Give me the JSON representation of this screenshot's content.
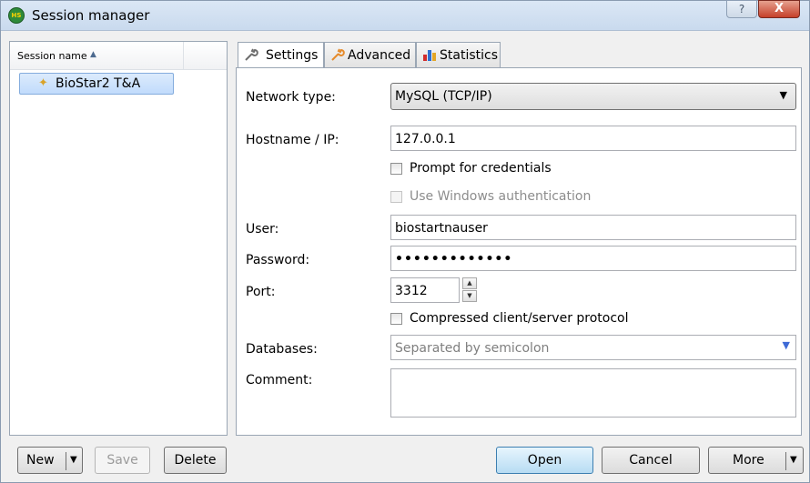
{
  "window": {
    "title": "Session manager",
    "app_icon_text": "HS",
    "help_glyph": "?",
    "close_glyph": "X"
  },
  "session_list": {
    "column_header": "Session name",
    "sort_icon": "▲",
    "sessions": [
      {
        "label": "BioStar2 T&A",
        "icon": "✦",
        "selected": true
      }
    ]
  },
  "tabs": [
    {
      "label": "Settings",
      "icon": "wrench-icon",
      "active": true
    },
    {
      "label": "Advanced",
      "icon": "wrench-orange-icon",
      "active": false
    },
    {
      "label": "Statistics",
      "icon": "bar-chart-icon",
      "active": false
    }
  ],
  "form": {
    "network_type": {
      "label": "Network type:",
      "value": "MySQL (TCP/IP)"
    },
    "hostname": {
      "label": "Hostname / IP:",
      "value": "127.0.0.1"
    },
    "prompt_credentials": {
      "label": "Prompt for credentials",
      "checked": false
    },
    "windows_auth": {
      "label": "Use Windows authentication",
      "checked": false,
      "disabled": true
    },
    "user": {
      "label": "User:",
      "value": "biostartnauser"
    },
    "password": {
      "label": "Password:",
      "value": "•••••••••••••"
    },
    "port": {
      "label": "Port:",
      "value": "3312"
    },
    "compressed": {
      "label": "Compressed client/server protocol",
      "checked": false
    },
    "databases": {
      "label": "Databases:",
      "placeholder": "Separated by semicolon"
    },
    "comment": {
      "label": "Comment:",
      "value": ""
    }
  },
  "buttons": {
    "new": "New",
    "save": "Save",
    "delete": "Delete",
    "open": "Open",
    "cancel": "Cancel",
    "more": "More",
    "arrow_down": "▼",
    "spin_up": "▲",
    "spin_down": "▼"
  },
  "colors": {
    "selection_fill": "#c1dbfc",
    "default_button": "#b7dcf3",
    "close_button": "#c5402a"
  }
}
